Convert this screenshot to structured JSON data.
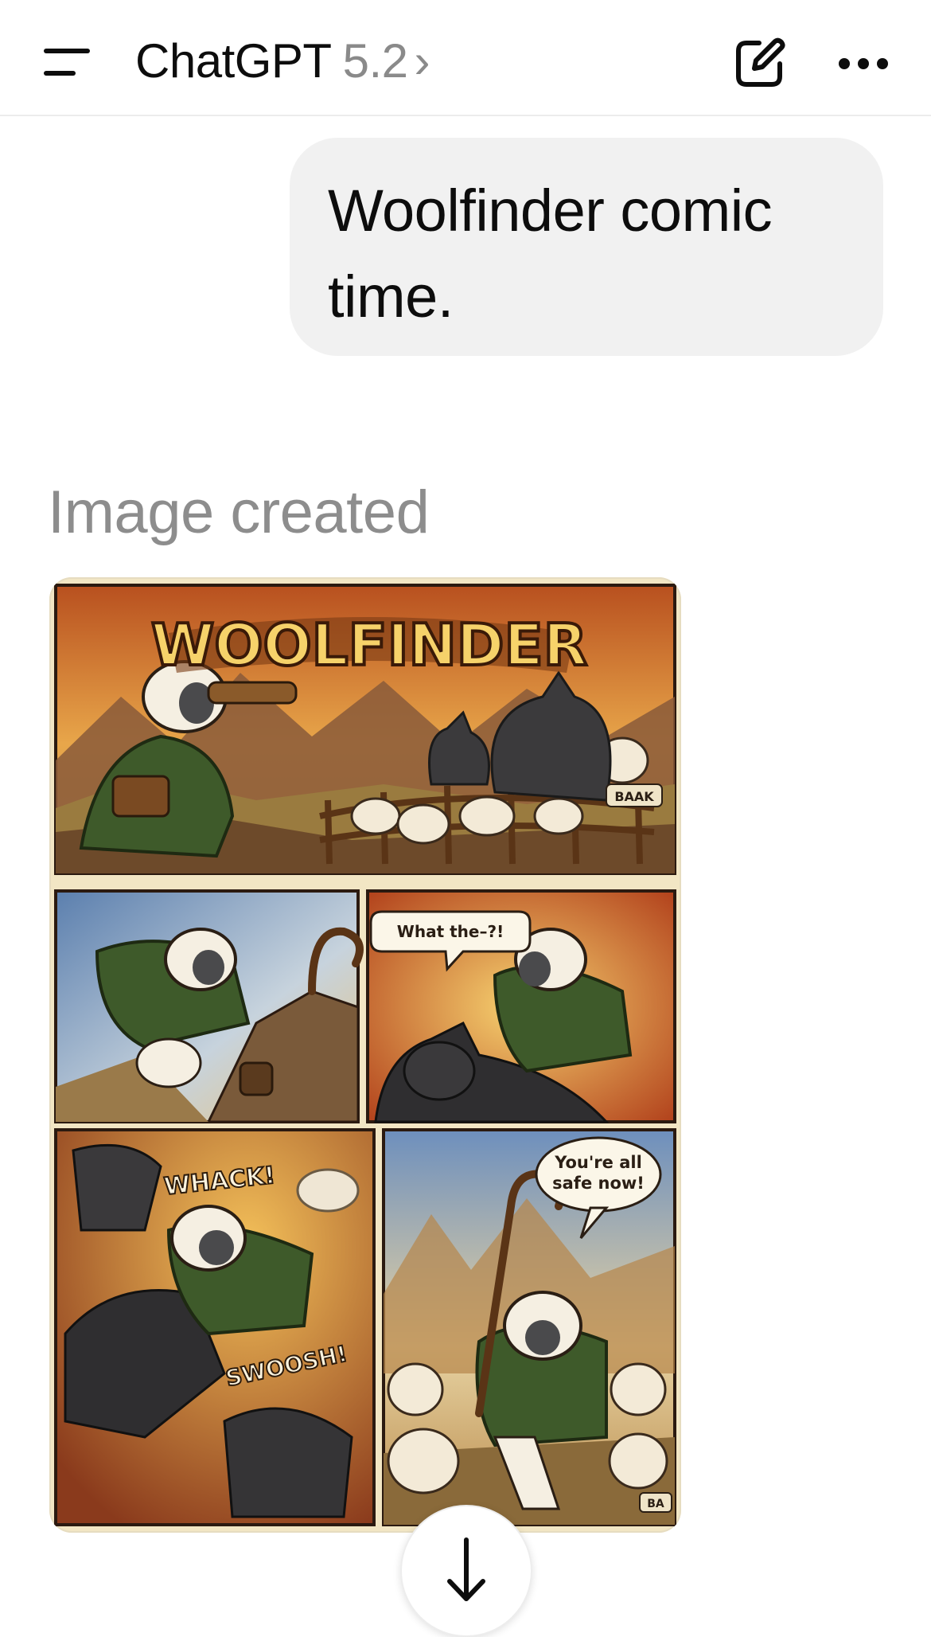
{
  "header": {
    "app_name": "ChatGPT",
    "model": "5.2",
    "chevron": "›",
    "icons": {
      "menu": "menu-icon",
      "new_chat": "edit-icon",
      "more": "more-icon"
    }
  },
  "conversation": {
    "user_message": "Woolfinder comic time.",
    "assistant_status": "Image created"
  },
  "comic": {
    "title": "WOOLFINDER",
    "sfx_baa_1": "BAAK",
    "speech_1": "What the–?!",
    "sfx_whack": "WHACK!",
    "sfx_swoosh": "SWOOSH!",
    "speech_2_line1": "You're all",
    "speech_2_line2": "safe now!",
    "sfx_baa_2": "BA"
  },
  "actions": {
    "download_icon": "download-arrow-icon"
  },
  "colors": {
    "bubble_bg": "#f1f1f1",
    "muted_text": "#8d8d8d",
    "comic_frame": "#f2e6c4"
  }
}
